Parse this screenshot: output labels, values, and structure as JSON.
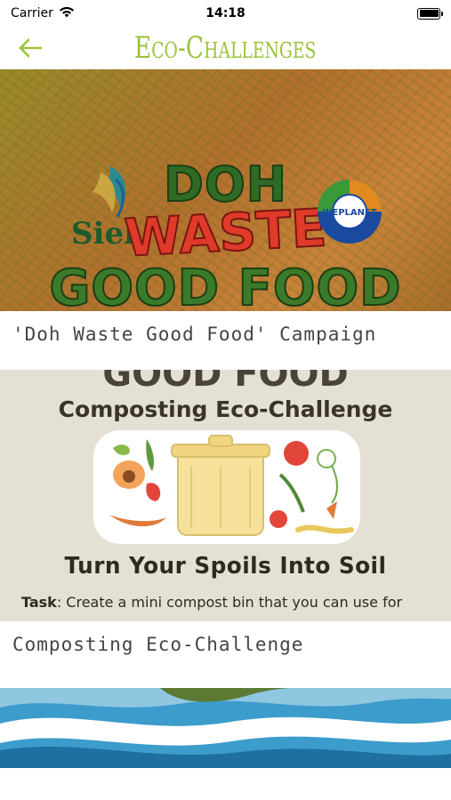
{
  "status_bar": {
    "carrier": "Carrier",
    "time": "14:18"
  },
  "header": {
    "title": "Eco-Challenges",
    "accent_color": "#9bc33d"
  },
  "challenges": [
    {
      "label": "'Doh Waste Good Food' Campaign",
      "image": {
        "line1": "DOH",
        "line2": "WASTE",
        "line3": "GOOD FOOD",
        "logo_left": "Siel",
        "logo_right": "WEPLANET"
      }
    },
    {
      "label": "Composting Eco-Challenge",
      "image": {
        "top_partial": "GOOD FOOD",
        "title": "Composting Eco-Challenge",
        "subtitle": "Turn Your Spoils Into Soil",
        "task_label": "Task",
        "task_text": ": Create a mini compost bin that you can use for"
      }
    },
    {
      "label": ""
    }
  ]
}
